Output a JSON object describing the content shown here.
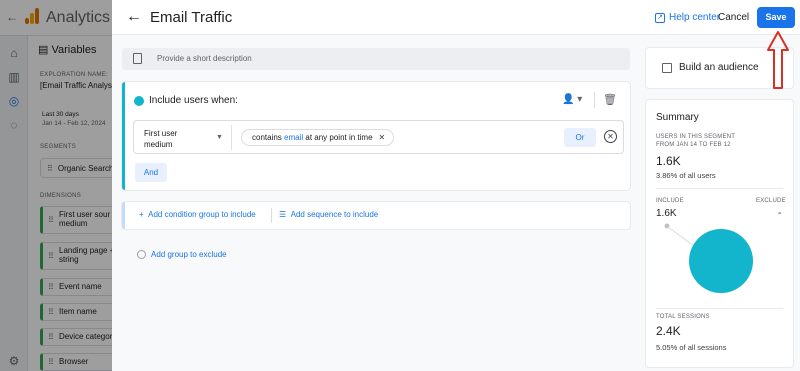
{
  "background": {
    "app_title": "Analytics",
    "variables_title": "Variables",
    "exploration_name_label": "EXPLORATION NAME:",
    "exploration_name": "[Email Traffic Analys",
    "date_label": "Last 30 days",
    "date_range": "Jan 14 - Feb 12, 2024",
    "segments_label": "SEGMENTS",
    "segment_item": "Organic Search",
    "dimensions_label": "DIMENSIONS",
    "dimensions": [
      "First user sour medium",
      "Landing page + string",
      "Event name",
      "Item name",
      "Device categor",
      "Browser"
    ]
  },
  "dialog": {
    "title": "Email Traffic",
    "help_label": "Help center",
    "cancel_label": "Cancel",
    "save_label": "Save",
    "description_placeholder": "Provide a short description",
    "include_label": "Include users when:",
    "condition": {
      "dimension": "First user medium",
      "pill_prefix": "contains ",
      "pill_value": "email",
      "pill_suffix": " at any point in time",
      "or_label": "Or"
    },
    "and_label": "And",
    "add_condition_group": "Add condition group to include",
    "add_sequence": "Add sequence to include",
    "add_group_exclude": "Add group to exclude"
  },
  "audience": {
    "label": "Build an audience"
  },
  "summary": {
    "title": "Summary",
    "users_caption_1": "USERS IN THIS SEGMENT",
    "users_caption_2": "FROM JAN 14 TO FEB 12",
    "users_value": "1.6K",
    "users_pct": "3.86% of all users",
    "include_label": "INCLUDE",
    "exclude_label": "EXCLUDE",
    "include_value": "1.6K",
    "exclude_value": "-",
    "sessions_caption": "TOTAL SESSIONS",
    "sessions_value": "2.4K",
    "sessions_pct": "5.05% of all sessions",
    "pie_color": "#12b5cb"
  },
  "colors": {
    "accent": "#1a73e8",
    "segment": "#12b5cb",
    "annotation": "#d93025"
  }
}
